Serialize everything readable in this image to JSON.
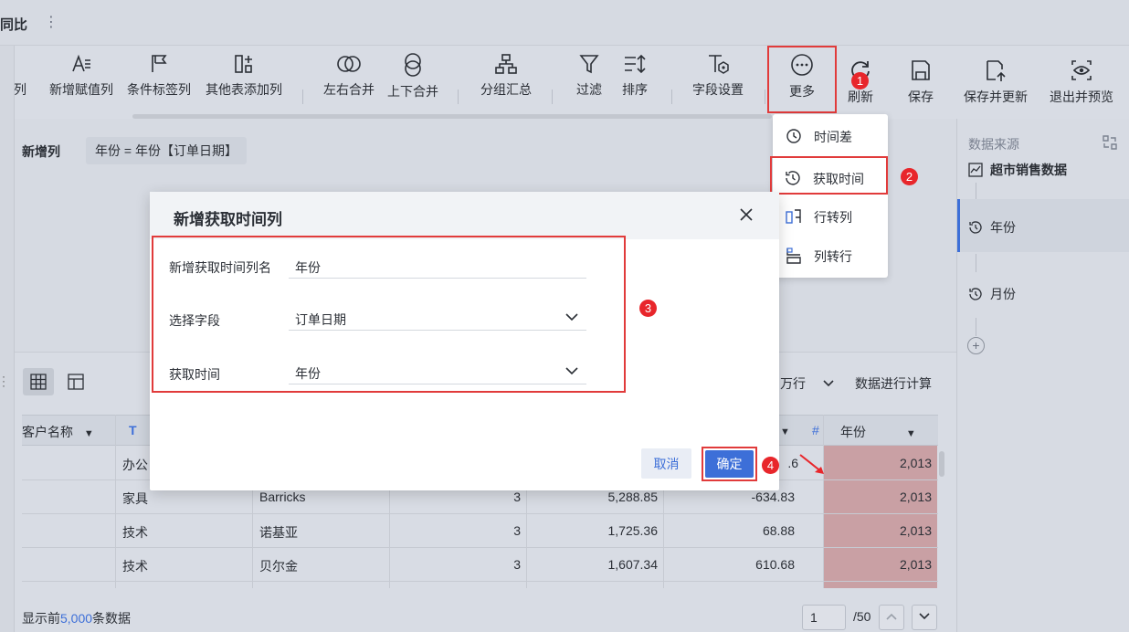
{
  "topbar": {
    "title": "同比",
    "more_dots": "⋮"
  },
  "toolbar": {
    "items": [
      {
        "label": "段列"
      },
      {
        "label": "新增赋值列"
      },
      {
        "label": "条件标签列"
      },
      {
        "label": "其他表添加列"
      },
      {
        "label": "左右合并"
      },
      {
        "label": "上下合并"
      },
      {
        "label": "分组汇总"
      },
      {
        "label": "过滤"
      },
      {
        "label": "排序"
      },
      {
        "label": "字段设置"
      },
      {
        "label": "更多"
      },
      {
        "label": "刷新"
      },
      {
        "label": "保存"
      },
      {
        "label": "保存并更新"
      },
      {
        "label": "退出并预览"
      }
    ]
  },
  "formula": {
    "label": "新增列",
    "expression": "年份 = 年份【订单日期】"
  },
  "menu": {
    "items": [
      {
        "label": "时间差",
        "icon": "clock-icon"
      },
      {
        "label": "获取时间",
        "icon": "clock-rewind-icon"
      },
      {
        "label": "行转列",
        "icon": "row-to-col-icon"
      },
      {
        "label": "列转行",
        "icon": "col-to-row-icon"
      }
    ]
  },
  "badges": {
    "b1": "1",
    "b2": "2",
    "b3": "3",
    "b4": "4"
  },
  "dialog": {
    "title": "新增获取时间列",
    "fields": [
      {
        "label": "新增获取时间列名",
        "value": "年份"
      },
      {
        "label": "选择字段",
        "value": "订单日期"
      },
      {
        "label": "获取时间",
        "value": "年份"
      }
    ],
    "cancel": "取消",
    "ok": "确定"
  },
  "right_panel": {
    "title": "数据来源",
    "source": "超市销售数据",
    "steps": [
      "年份",
      "月份"
    ],
    "add": "+"
  },
  "table": {
    "unit_select": "万行",
    "calc_text": "数据进行计算",
    "headers": {
      "customer": "客户名称",
      "t_icon": "T",
      "hash_icon": "#",
      "year": "年份"
    },
    "rows": [
      {
        "category": "办公",
        "name": "",
        "qty": "",
        "sales": "",
        "profit": ".6",
        "year": "2,013"
      },
      {
        "category": "家具",
        "name": "Barricks",
        "qty": "3",
        "sales": "5,288.85",
        "profit": "-634.83",
        "year": "2,013"
      },
      {
        "category": "技术",
        "name": "诺基亚",
        "qty": "3",
        "sales": "1,725.36",
        "profit": "68.88",
        "year": "2,013"
      },
      {
        "category": "技术",
        "name": "贝尔金",
        "qty": "3",
        "sales": "1,607.34",
        "profit": "610.68",
        "year": "2,013"
      }
    ],
    "footer_prefix": "显示前",
    "footer_count": "5,000",
    "footer_suffix": "条数据",
    "page_current": "1",
    "page_total": "/50"
  },
  "colors": {
    "accent": "#3d6fd8",
    "highlight": "#e13b3b",
    "badge": "#e8262b"
  }
}
